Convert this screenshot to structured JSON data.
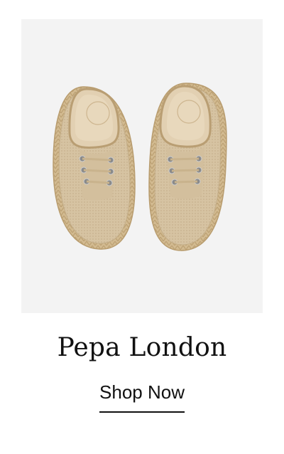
{
  "product": {
    "brand": "Pepa London",
    "cta_label": "Shop Now",
    "image_icon": "espadrille-shoes-image",
    "image_background": "#f3f3f3",
    "shoe_color": "#d9c6a6"
  }
}
